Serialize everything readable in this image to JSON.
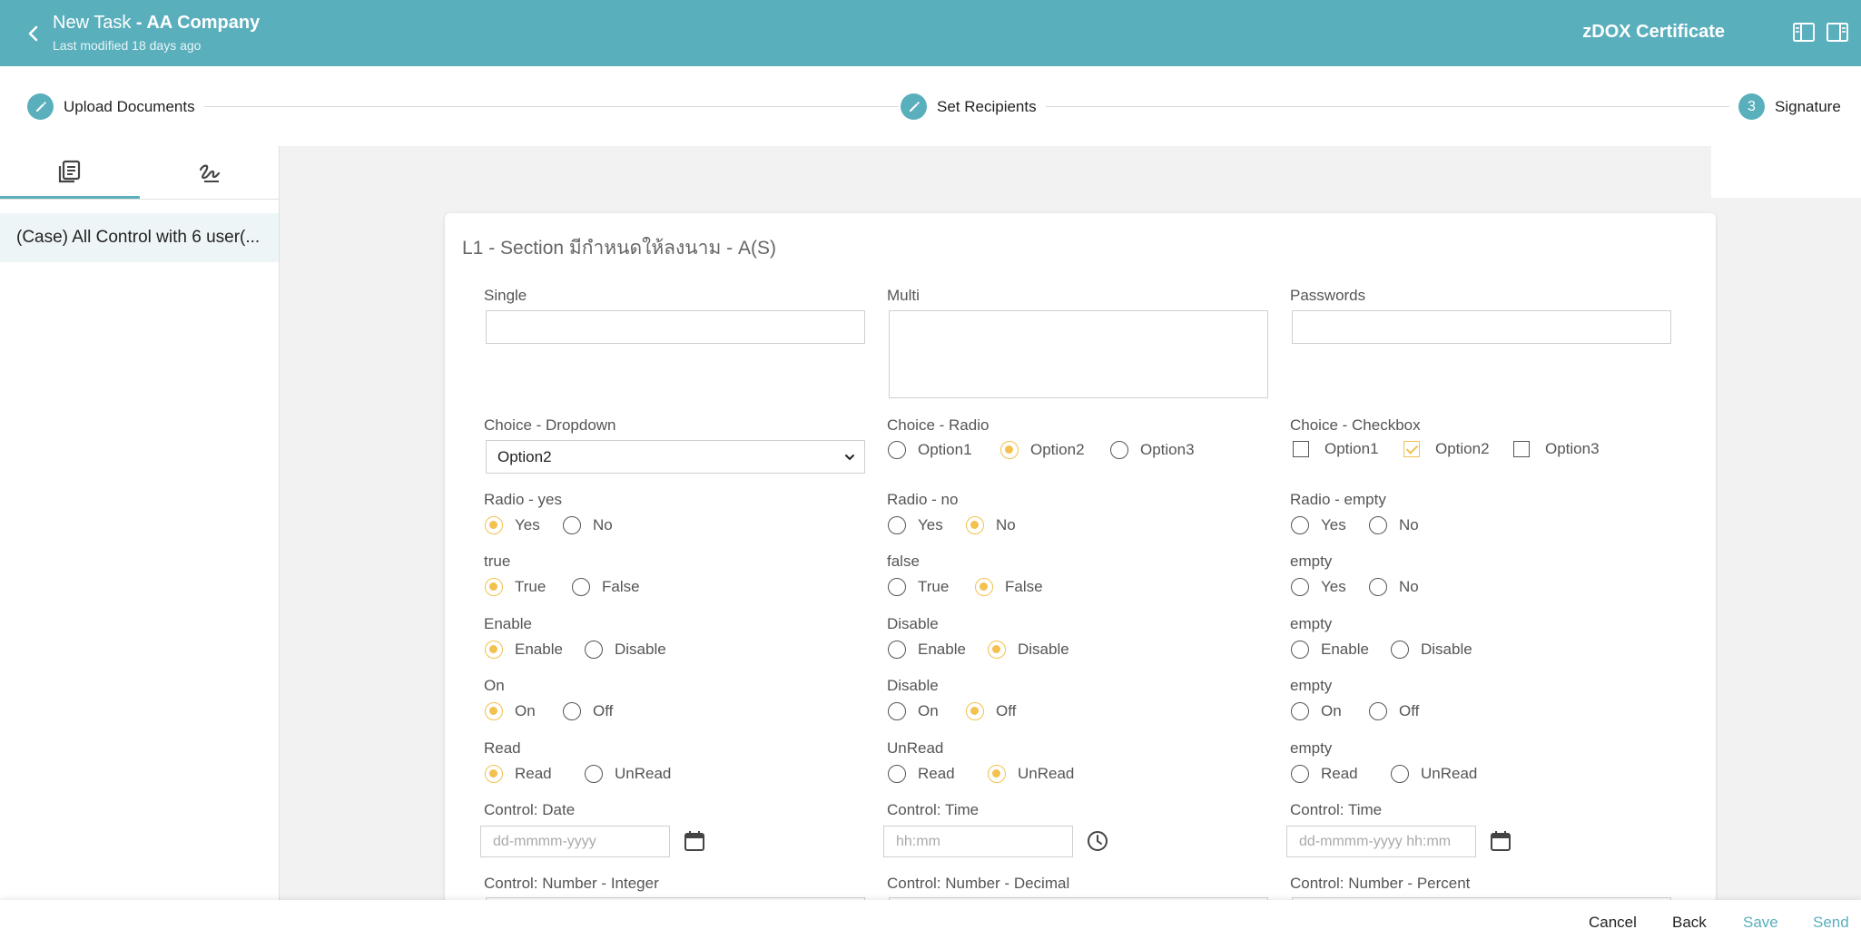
{
  "header": {
    "title_prefix": "New Task",
    "title_company": "- AA Company",
    "subtitle": "Last modified 18 days ago",
    "app_name": "zDOX Certificate"
  },
  "stepper": {
    "steps": [
      {
        "label": "Upload Documents",
        "icon": "pencil-icon"
      },
      {
        "label": "Set Recipients",
        "icon": "pencil-icon"
      },
      {
        "label": "Signature",
        "number": "3"
      }
    ]
  },
  "sidebar": {
    "tabs": [
      {
        "icon": "documents-icon"
      },
      {
        "icon": "signature-icon"
      }
    ],
    "document": "(Case) All Control with 6 user(..."
  },
  "form": {
    "section_title": "L1 - Section มีกำหนดให้ลงนาม - A(S)",
    "single_label": "Single",
    "multi_label": "Multi",
    "passwords_label": "Passwords",
    "dropdown_label": "Choice - Dropdown",
    "dropdown_value": "Option2",
    "choice_radio_label": "Choice - Radio",
    "choice_radio_options": [
      "Option1",
      "Option2",
      "Option3"
    ],
    "choice_radio_selected": "Option2",
    "choice_checkbox_label": "Choice - Checkbox",
    "choice_checkbox_options": [
      "Option1",
      "Option2",
      "Option3"
    ],
    "choice_checkbox_checked": [
      "Option2"
    ],
    "radio_groups": [
      {
        "label": "Radio - yes",
        "options": [
          "Yes",
          "No"
        ],
        "selected": "Yes"
      },
      {
        "label": "Radio - no",
        "options": [
          "Yes",
          "No"
        ],
        "selected": "No"
      },
      {
        "label": "Radio - empty",
        "options": [
          "Yes",
          "No"
        ],
        "selected": ""
      },
      {
        "label": "true",
        "options": [
          "True",
          "False"
        ],
        "selected": "True"
      },
      {
        "label": "false",
        "options": [
          "True",
          "False"
        ],
        "selected": "False"
      },
      {
        "label": "empty",
        "options": [
          "Yes",
          "No"
        ],
        "selected": ""
      },
      {
        "label": "Enable",
        "options": [
          "Enable",
          "Disable"
        ],
        "selected": "Enable"
      },
      {
        "label": "Disable",
        "options": [
          "Enable",
          "Disable"
        ],
        "selected": "Disable"
      },
      {
        "label": "empty",
        "options": [
          "Enable",
          "Disable"
        ],
        "selected": ""
      },
      {
        "label": "On",
        "options": [
          "On",
          "Off"
        ],
        "selected": "On"
      },
      {
        "label": "Disable",
        "options": [
          "On",
          "Off"
        ],
        "selected": "Off"
      },
      {
        "label": "empty",
        "options": [
          "On",
          "Off"
        ],
        "selected": ""
      },
      {
        "label": "Read",
        "options": [
          "Read",
          "UnRead"
        ],
        "selected": "Read"
      },
      {
        "label": "UnRead",
        "options": [
          "Read",
          "UnRead"
        ],
        "selected": "UnRead"
      },
      {
        "label": "empty",
        "options": [
          "Read",
          "UnRead"
        ],
        "selected": ""
      }
    ],
    "date_label": "Control: Date",
    "date_placeholder": "dd-mmmm-yyyy",
    "time_label": "Control: Time",
    "time_placeholder": "hh:mm",
    "datetime_label": "Control: Time",
    "datetime_placeholder": "dd-mmmm-yyyy hh:mm",
    "number_integer_label": "Control: Number - Integer",
    "number_decimal_label": "Control: Number - Decimal",
    "number_percent_label": "Control: Number - Percent"
  },
  "footer": {
    "cancel": "Cancel",
    "back": "Back",
    "save": "Save",
    "send": "Send"
  },
  "colors": {
    "brand": "#5aafbd",
    "accent": "#f2c14e"
  }
}
